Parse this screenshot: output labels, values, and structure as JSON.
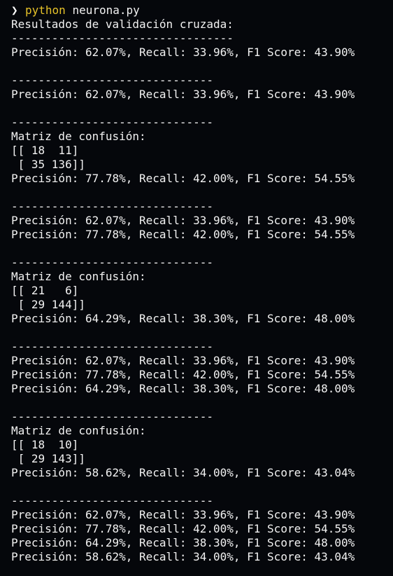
{
  "prompt": {
    "icon": "chevron-right-icon",
    "glyph": "❯",
    "command": "python",
    "argument": "neurona.py"
  },
  "lines": [
    "Resultados de validación cruzada:",
    "---------------------------------",
    "Precisión: 62.07%, Recall: 33.96%, F1 Score: 43.90%",
    "",
    "------------------------------",
    "Precisión: 62.07%, Recall: 33.96%, F1 Score: 43.90%",
    "",
    "------------------------------",
    "Matriz de confusión:",
    "[[ 18  11]",
    " [ 35 136]]",
    "Precisión: 77.78%, Recall: 42.00%, F1 Score: 54.55%",
    "",
    "------------------------------",
    "Precisión: 62.07%, Recall: 33.96%, F1 Score: 43.90%",
    "Precisión: 77.78%, Recall: 42.00%, F1 Score: 54.55%",
    "",
    "------------------------------",
    "Matriz de confusión:",
    "[[ 21   6]",
    " [ 29 144]]",
    "Precisión: 64.29%, Recall: 38.30%, F1 Score: 48.00%",
    "",
    "------------------------------",
    "Precisión: 62.07%, Recall: 33.96%, F1 Score: 43.90%",
    "Precisión: 77.78%, Recall: 42.00%, F1 Score: 54.55%",
    "Precisión: 64.29%, Recall: 38.30%, F1 Score: 48.00%",
    "",
    "------------------------------",
    "Matriz de confusión:",
    "[[ 18  10]",
    " [ 29 143]]",
    "Precisión: 58.62%, Recall: 34.00%, F1 Score: 43.04%",
    "",
    "------------------------------",
    "Precisión: 62.07%, Recall: 33.96%, F1 Score: 43.90%",
    "Precisión: 77.78%, Recall: 42.00%, F1 Score: 54.55%",
    "Precisión: 64.29%, Recall: 38.30%, F1 Score: 48.00%",
    "Precisión: 58.62%, Recall: 34.00%, F1 Score: 43.04%"
  ],
  "colors": {
    "background": "#05070b",
    "text": "#f2f2f2",
    "command": "#e6c229"
  }
}
